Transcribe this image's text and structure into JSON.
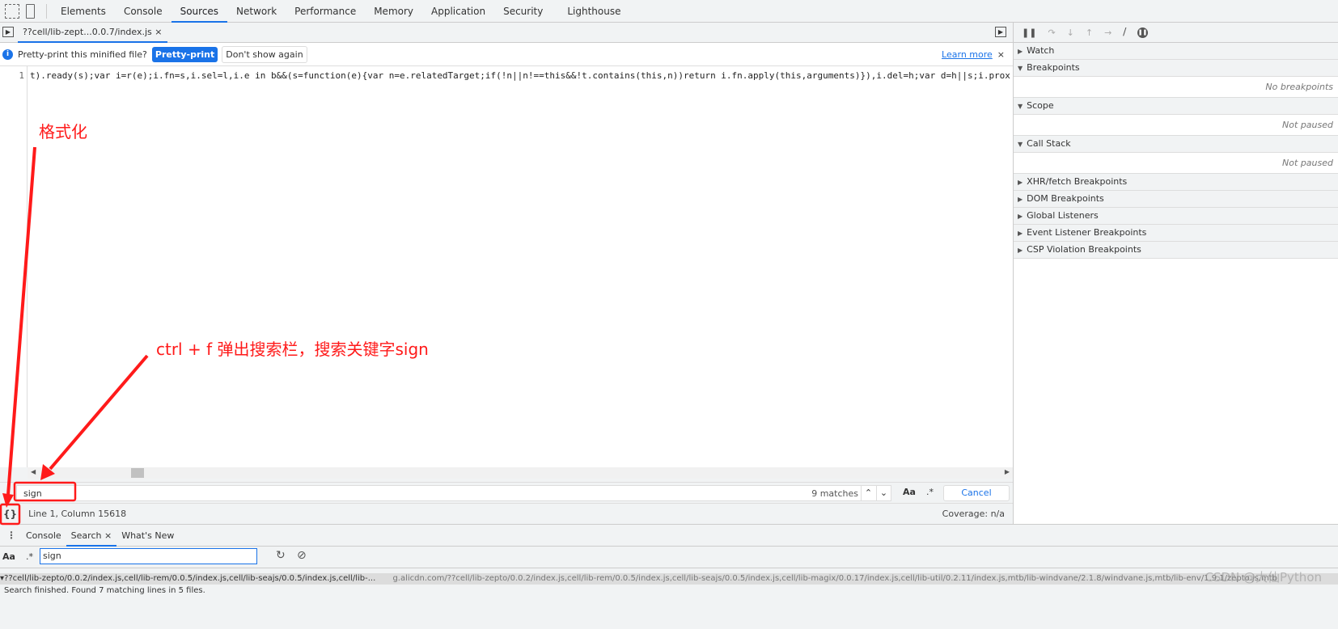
{
  "toolbar": {
    "tabs": [
      "Elements",
      "Console",
      "Sources",
      "Network",
      "Performance",
      "Memory",
      "Application",
      "Security",
      "Lighthouse"
    ],
    "active": "Sources"
  },
  "file_tab": {
    "label": "??cell/lib-zept...0.0.7/index.js",
    "close": "×"
  },
  "infobar": {
    "message": "Pretty-print this minified file?",
    "pretty_print": "Pretty-print",
    "dont_show": "Don't show again",
    "learn_more": "Learn more",
    "close": "×"
  },
  "editor": {
    "line_number": "1",
    "code": "t).ready(s);var i=r(e);i.fn=s,i.sel=l,i.e in b&&(s=function(e){var n=e.relatedTarget;if(!n||n!==this&&!t.contains(this,n))return i.fn.apply(this,arguments)}),i.del=h;var d=h||s;i.proxy=function(t"
  },
  "find_bar": {
    "value": "sign",
    "matches": "9 matches",
    "case_label": "Aa",
    "regex_label": ".*",
    "cancel": "Cancel"
  },
  "status": {
    "format_icon": "{}",
    "position": "Line 1, Column 15618",
    "coverage": "Coverage: n/a"
  },
  "debugger": {
    "sections": [
      {
        "label": "Watch",
        "expanded": false
      },
      {
        "label": "Breakpoints",
        "expanded": true,
        "empty": "No breakpoints"
      },
      {
        "label": "Scope",
        "expanded": true,
        "empty": "Not paused"
      },
      {
        "label": "Call Stack",
        "expanded": true,
        "empty": "Not paused"
      },
      {
        "label": "XHR/fetch Breakpoints",
        "expanded": false
      },
      {
        "label": "DOM Breakpoints",
        "expanded": false
      },
      {
        "label": "Global Listeners",
        "expanded": false
      },
      {
        "label": "Event Listener Breakpoints",
        "expanded": false
      },
      {
        "label": "CSP Violation Breakpoints",
        "expanded": false
      }
    ]
  },
  "drawer": {
    "tabs": [
      "Console",
      "Search",
      "What's New"
    ],
    "active": "Search",
    "close": "×",
    "search_value": "sign",
    "case_label": "Aa",
    "regex_label": ".*",
    "result_file": "??cell/lib-zepto/0.0.2/index.js,cell/lib-rem/0.0.5/index.js,cell/lib-seajs/0.0.5/index.js,cell/lib-...",
    "result_url": "g.alicdn.com/??cell/lib-zepto/0.0.2/index.js,cell/lib-rem/0.0.5/index.js,cell/lib-seajs/0.0.5/index.js,cell/lib-magix/0.0.17/index.js,cell/lib-util/0.2.11/index.js,mtb/lib-windvane/2.1.8/windvane.js,mtb/lib-env/1.9.1/zepto.js,mtb",
    "status": "Search finished.  Found 7 matching lines in 5 files."
  },
  "annotations": {
    "format": "格式化",
    "search_hint": "ctrl + f 弹出搜索栏，搜索关键字sign",
    "color": "#ff1a1a"
  },
  "watermark": "CSDN @大仙Python",
  "colors": {
    "accent": "#1a73e8",
    "annotation": "#ff1a1a"
  }
}
